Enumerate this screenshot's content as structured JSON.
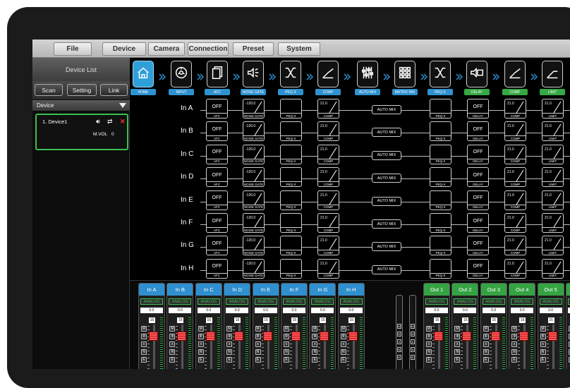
{
  "menu": [
    "File",
    "Device",
    "Camera",
    "Connection",
    "Preset",
    "System"
  ],
  "left_panel": {
    "title": "Device List",
    "buttons": [
      "Scan",
      "Setting",
      "Link"
    ],
    "device_header": "Device",
    "device": {
      "name": "1. Device1",
      "mvol_label": "M.VOL",
      "mvol_value": "0"
    }
  },
  "modules": [
    {
      "label": "HOME",
      "icon": "home-icon",
      "color": "blue"
    },
    {
      "label": "INPUT",
      "icon": "input-jack-icon",
      "color": "blue"
    },
    {
      "label": "AFC",
      "icon": "pages-icon",
      "color": "blue"
    },
    {
      "label": "NOISE GATE",
      "icon": "speaker-gate-icon",
      "color": "blue"
    },
    {
      "label": "PEQ-X",
      "icon": "crossover-icon",
      "color": "blue"
    },
    {
      "label": "COMP",
      "icon": "compressor-curve-icon",
      "color": "blue"
    },
    {
      "label": "AUTO MIX",
      "icon": "faders-icon",
      "color": "blue"
    },
    {
      "label": "MATRIX MIX",
      "icon": "matrix-grid-icon",
      "color": "blue"
    },
    {
      "label": "PEQ-X",
      "icon": "crossover-icon",
      "color": "blue"
    },
    {
      "label": "DELAY",
      "icon": "speaker-delay-icon",
      "color": "green"
    },
    {
      "label": "COMP",
      "icon": "compressor-curve-icon",
      "color": "green"
    },
    {
      "label": "LIMIT",
      "icon": "limiter-curve-icon",
      "color": "green"
    }
  ],
  "channels": [
    "In A",
    "In B",
    "In C",
    "In D",
    "In E",
    "In F",
    "In G",
    "In H"
  ],
  "blocks": {
    "afc_value": "OFF",
    "afc_label": "AFC",
    "gate_value": "-120.0",
    "gate_label": "NOISE GATE",
    "peq_label": "PEQ-X",
    "comp_value": "21.0",
    "comp_label": "COMP",
    "automix_label": "AUTO MIX",
    "delay_value": "OFF",
    "delay_label": "DELAY",
    "comp2_value": "21.0",
    "comp2_label": "COMP",
    "limit_value": "21.0",
    "limit_label": "LIMIT"
  },
  "mixer": {
    "inputs": [
      "In A",
      "In B",
      "In C",
      "In D",
      "In E",
      "In F",
      "In G",
      "In H"
    ],
    "outputs": [
      "Out 1",
      "Out 2",
      "Out 3",
      "Out 4",
      "Out 5",
      "Out 6",
      "O"
    ],
    "analog_label": "ANALOG",
    "gain_value": "0.0",
    "fader_value": "15",
    "in_buttons": [
      "M",
      "Φ",
      "∧",
      "N",
      "E"
    ],
    "out_buttons": [
      "M",
      "Φ",
      "∧",
      "N",
      "E"
    ],
    "mid_buttons": [
      "M",
      "Φ",
      "∧",
      "N",
      "E"
    ]
  },
  "colors": {
    "input_blue": "#2f8fcf",
    "output_green": "#35a343",
    "fader_red": "#e02a2a"
  }
}
